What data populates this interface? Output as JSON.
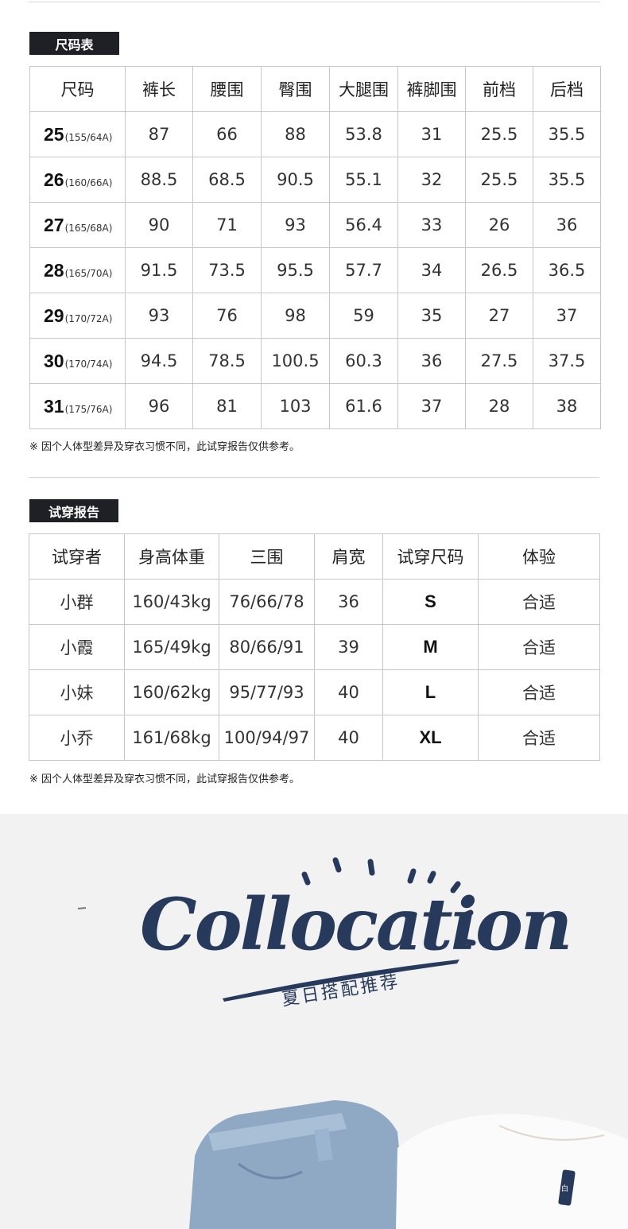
{
  "size_section": {
    "tag": "尺码表",
    "headers": [
      "尺码",
      "裤长",
      "腰围",
      "臀围",
      "大腿围",
      "裤脚围",
      "前档",
      "后档"
    ],
    "rows": [
      {
        "size": "25",
        "spec": "(155/64A)",
        "values": [
          "87",
          "66",
          "88",
          "53.8",
          "31",
          "25.5",
          "35.5"
        ]
      },
      {
        "size": "26",
        "spec": "(160/66A)",
        "values": [
          "88.5",
          "68.5",
          "90.5",
          "55.1",
          "32",
          "25.5",
          "35.5"
        ]
      },
      {
        "size": "27",
        "spec": "(165/68A)",
        "values": [
          "90",
          "71",
          "93",
          "56.4",
          "33",
          "26",
          "36"
        ]
      },
      {
        "size": "28",
        "spec": "(165/70A)",
        "values": [
          "91.5",
          "73.5",
          "95.5",
          "57.7",
          "34",
          "26.5",
          "36.5"
        ]
      },
      {
        "size": "29",
        "spec": "(170/72A)",
        "values": [
          "93",
          "76",
          "98",
          "59",
          "35",
          "27",
          "37"
        ]
      },
      {
        "size": "30",
        "spec": "(170/74A)",
        "values": [
          "94.5",
          "78.5",
          "100.5",
          "60.3",
          "36",
          "27.5",
          "37.5"
        ]
      },
      {
        "size": "31",
        "spec": "(175/76A)",
        "values": [
          "96",
          "81",
          "103",
          "61.6",
          "37",
          "28",
          "38"
        ]
      }
    ],
    "note": "※ 因个人体型差异及穿衣习惯不同，此试穿报告仅供参考。"
  },
  "fit_section": {
    "tag": "试穿报告",
    "headers": [
      "试穿者",
      "身高体重",
      "三围",
      "肩宽",
      "试穿尺码",
      "体验"
    ],
    "rows": [
      [
        "小群",
        "160/43kg",
        "76/66/78",
        "36",
        "S",
        "合适"
      ],
      [
        "小霞",
        "165/49kg",
        "80/66/91",
        "39",
        "M",
        "合适"
      ],
      [
        "小妹",
        "160/62kg",
        "95/77/93",
        "40",
        "L",
        "合适"
      ],
      [
        "小乔",
        "161/68kg",
        "100/94/97",
        "40",
        "XL",
        "合适"
      ]
    ],
    "note": "※ 因个人体型差异及穿衣习惯不同，此试穿报告仅供参考。"
  },
  "collocation": {
    "title": "Collocation",
    "subtitle": "夏日搭配推荐",
    "tshirt_tag": "白"
  },
  "colors": {
    "tag_bg": "#1f1f26",
    "brand_navy": "#283a5c",
    "border": "#c8c8c8",
    "section_bg": "#f2f2f2"
  }
}
